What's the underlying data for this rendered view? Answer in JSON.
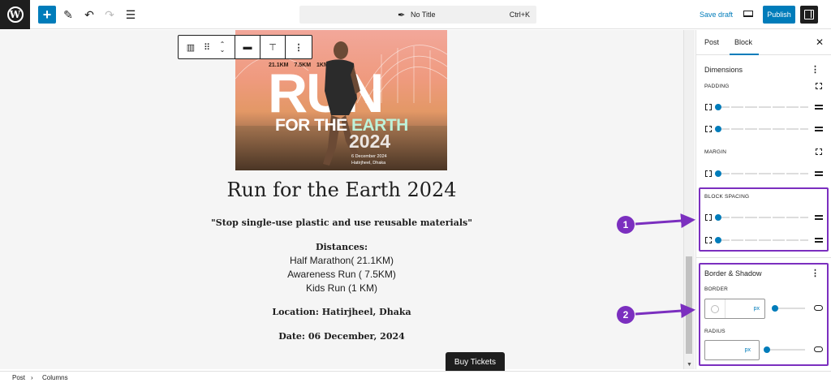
{
  "header": {
    "document_title": "No Title",
    "shortcut": "Ctrl+K",
    "save_draft": "Save draft",
    "publish": "Publish"
  },
  "hero": {
    "distances": "21.1KM 7.5KM 1KM",
    "run": "RUN",
    "for_the": "FOR THE ",
    "earth": "EARTH",
    "year": "2024",
    "date_line1": "6 December 2024",
    "date_line2": "Hatirjheel, Dhaka"
  },
  "post": {
    "title": "Run for the Earth 2024",
    "quote": "\"Stop single-use plastic and use reusable materials\"",
    "distances_heading": "Distances:",
    "distances": [
      "Half Marathon( 21.1KM)",
      "Awareness Run ( 7.5KM)",
      "Kids Run (1 KM)"
    ],
    "location": "Location: Hatirjheel, Dhaka",
    "date": "Date: 06 December, 2024",
    "buy_button": "Buy Tickets"
  },
  "sidebar": {
    "tabs": [
      "Post",
      "Block"
    ],
    "dimensions_heading": "Dimensions",
    "padding_label": "PADDING",
    "margin_label": "MARGIN",
    "block_spacing_label": "BLOCK SPACING",
    "border_shadow_heading": "Border & Shadow",
    "border_label": "BORDER",
    "radius_label": "RADIUS",
    "unit": "px"
  },
  "callouts": [
    "1",
    "2"
  ],
  "breadcrumb": [
    "Post",
    "Columns"
  ],
  "colors": {
    "accent": "#007cba",
    "highlight": "#7b2fbf",
    "dark": "#1e1e1e"
  }
}
